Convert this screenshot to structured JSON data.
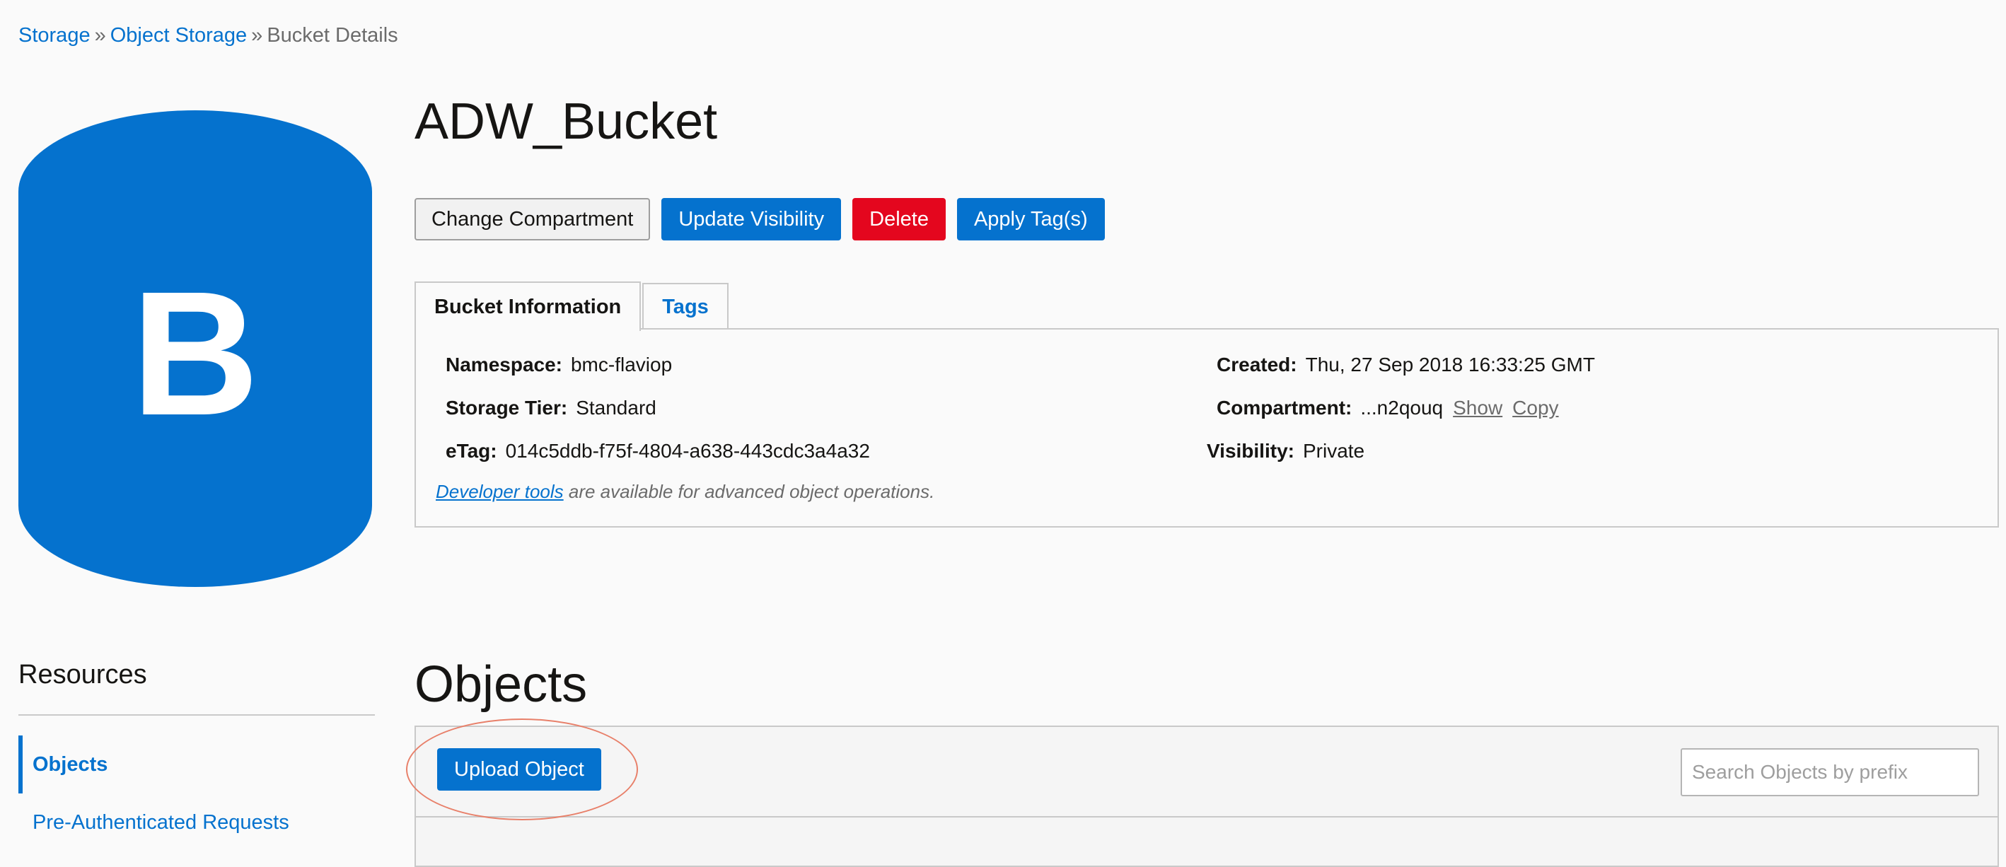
{
  "breadcrumb": {
    "items": [
      "Storage",
      "Object Storage",
      "Bucket Details"
    ],
    "separator": "»"
  },
  "bucket_icon": {
    "letter": "B",
    "color": "#0572ce"
  },
  "page_title": "ADW_Bucket",
  "actions": {
    "change_compartment": "Change Compartment",
    "update_visibility": "Update Visibility",
    "delete": "Delete",
    "apply_tags": "Apply Tag(s)"
  },
  "tabs": {
    "bucket_information": "Bucket Information",
    "tags": "Tags"
  },
  "info": {
    "namespace": {
      "label": "Namespace:",
      "value": "bmc-flaviop"
    },
    "storage_tier": {
      "label": "Storage Tier:",
      "value": "Standard"
    },
    "etag": {
      "label": "eTag:",
      "value": "014c5ddb-f75f-4804-a638-443cdc3a4a32"
    },
    "created": {
      "label": "Created:",
      "value": "Thu, 27 Sep 2018 16:33:25 GMT"
    },
    "compartment": {
      "label": "Compartment:",
      "value": "...n2qouq",
      "show": "Show",
      "copy": "Copy"
    },
    "visibility": {
      "label": "Visibility:",
      "value": "Private"
    },
    "developer_note": {
      "link": "Developer tools",
      "text": " are available for advanced object operations."
    }
  },
  "resources": {
    "title": "Resources",
    "items": [
      "Objects",
      "Pre-Authenticated Requests"
    ]
  },
  "objects": {
    "title": "Objects",
    "upload_button": "Upload Object",
    "search_placeholder": "Search Objects by prefix"
  },
  "colors": {
    "accent": "#0572ce",
    "danger": "#e4061e",
    "highlight": "#e8806a"
  }
}
